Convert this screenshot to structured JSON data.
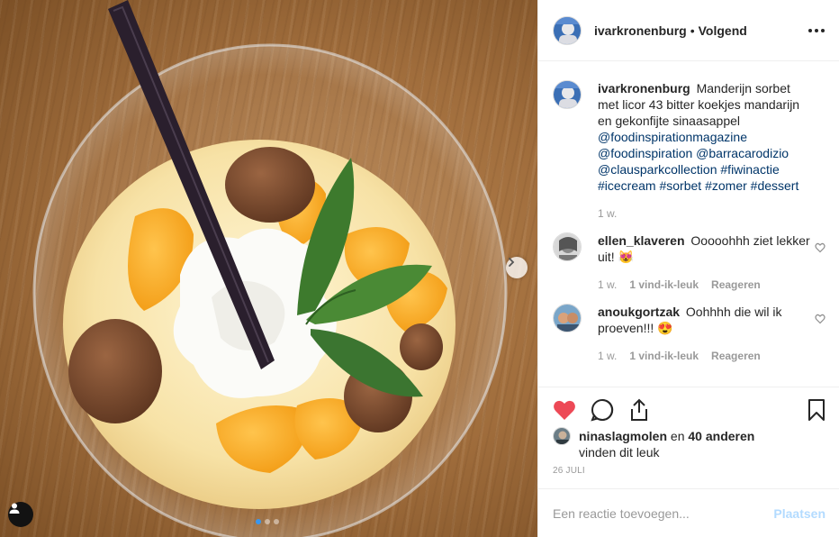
{
  "post": {
    "header": {
      "username": "ivarkronenburg",
      "separator": "•",
      "follow_label": "Volgend"
    },
    "caption": {
      "username": "ivarkronenburg",
      "text": "Manderijn sorbet met licor 43 bitter koekjes mandarijn en gekonfijte sinaasappel",
      "tags": [
        "@foodinspirationmagazine",
        "@foodinspiration",
        "@barracarodizio",
        "@clausparkcollection",
        "#fiwinactie",
        "#icecream",
        "#sorbet",
        "#zomer",
        "#dessert"
      ],
      "time": "1 w."
    },
    "comments": [
      {
        "username": "ellen_klaveren",
        "text": "Ooooohhh ziet lekker uit!",
        "emoji": "😻",
        "time": "1 w.",
        "likes": "1 vind-ik-leuk",
        "reply": "Reageren"
      },
      {
        "username": "anoukgortzak",
        "text": "Oohhhh die wil ik proeven!!!",
        "emoji": "😍",
        "time": "1 w.",
        "likes": "1 vind-ik-leuk",
        "reply": "Reageren"
      }
    ],
    "likes": {
      "user": "ninaslagmolen",
      "connector": "en",
      "others": "40 anderen",
      "suffix": "vinden dit leuk"
    },
    "date": "26 JULI",
    "add_comment": {
      "placeholder": "Een reactie toevoegen...",
      "button": "Plaatsen"
    },
    "carousel": {
      "slide_count": 3,
      "active_slide": 1
    }
  },
  "icons": {
    "like": "heart-filled-icon",
    "comment": "comment-icon",
    "share": "share-icon",
    "save": "bookmark-icon",
    "more": "more-options-icon",
    "next": "chevron-right-icon",
    "tag": "user-tag-icon",
    "comment_like": "heart-outline-icon"
  },
  "colors": {
    "like_red": "#ed4956",
    "link_blue": "#003569",
    "muted": "#999999",
    "post_button_disabled": "#b3dbff",
    "carousel_active": "#3897f0"
  }
}
